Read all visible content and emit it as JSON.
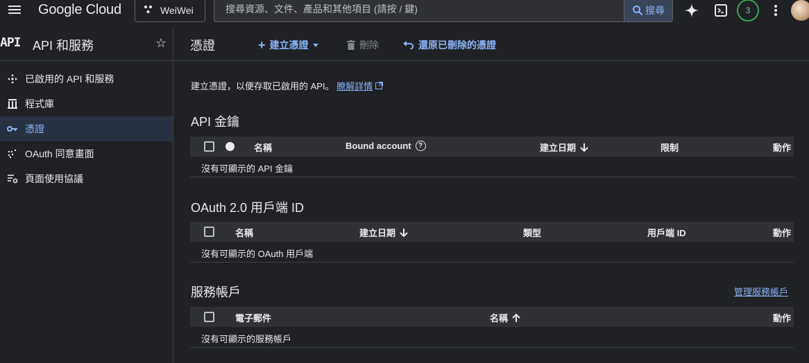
{
  "topbar": {
    "logo": "Google Cloud",
    "project": "WeiWei",
    "search_placeholder": "搜尋資源、文件、產品和其他項目 (請按 / 鍵)",
    "search_button": "搜尋",
    "notification_count": "3"
  },
  "sidebar": {
    "mark": "API",
    "title": "API 和服務",
    "items": [
      {
        "label": "已啟用的 API 和服務",
        "icon": "diamond-arrows-icon"
      },
      {
        "label": "程式庫",
        "icon": "library-icon"
      },
      {
        "label": "憑證",
        "icon": "key-icon",
        "active": true
      },
      {
        "label": "OAuth 同意畫面",
        "icon": "dots-grid-icon"
      },
      {
        "label": "頁面使用協議",
        "icon": "settings-list-icon"
      }
    ]
  },
  "page": {
    "title": "憑證",
    "actions": {
      "create": "建立憑證",
      "delete": "刪除",
      "restore": "還原已刪除的憑證"
    },
    "intro_text": "建立憑證，以便存取已啟用的 API。",
    "intro_link": "瞭解詳情"
  },
  "api_keys": {
    "title": "API 金鑰",
    "columns": [
      "名稱",
      "Bound account",
      "建立日期",
      "限制",
      "動作"
    ],
    "empty": "沒有可顯示的 API 金鑰"
  },
  "oauth": {
    "title": "OAuth 2.0 用戶端 ID",
    "columns": [
      "名稱",
      "建立日期",
      "類型",
      "用戶端 ID",
      "動作"
    ],
    "empty": "沒有可顯示的 OAuth 用戶端"
  },
  "service_accounts": {
    "title": "服務帳戶",
    "manage_link": "管理服務帳戶",
    "columns": [
      "電子郵件",
      "名稱",
      "動作"
    ],
    "empty": "沒有可顯示的服務帳戶"
  },
  "colors": {
    "background": "#202124",
    "accent": "#8ab4f8",
    "active_nav_bg": "#283142",
    "header_row_bg": "#303134",
    "badge_ring": "#34a853"
  }
}
